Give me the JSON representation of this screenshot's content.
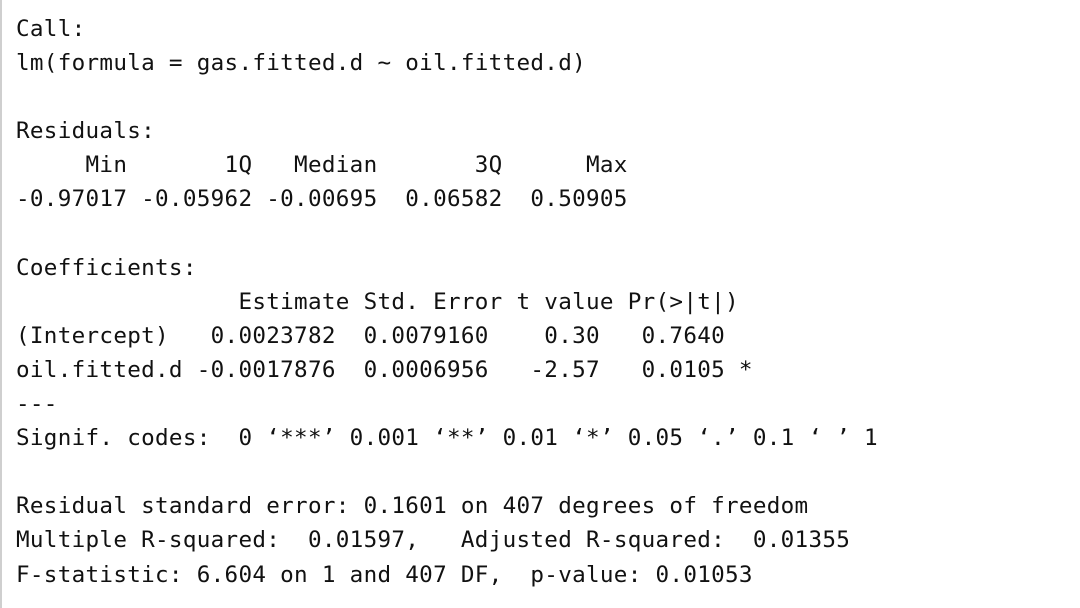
{
  "console": {
    "lines": [
      "Call:",
      "lm(formula = gas.fitted.d ~ oil.fitted.d)",
      "",
      "Residuals:",
      "     Min       1Q   Median       3Q      Max ",
      "-0.97017 -0.05962 -0.00695  0.06582  0.50905 ",
      "",
      "Coefficients:",
      "                Estimate Std. Error t value Pr(>|t|)  ",
      "(Intercept)   0.0023782  0.0079160    0.30   0.7640  ",
      "oil.fitted.d -0.0017876  0.0006956   -2.57   0.0105 *",
      "---",
      "Signif. codes:  0 ‘***’ 0.001 ‘**’ 0.01 ‘*’ 0.05 ‘.’ 0.1 ‘ ’ 1",
      "",
      "Residual standard error: 0.1601 on 407 degrees of freedom",
      "Multiple R-squared:  0.01597,\tAdjusted R-squared:  0.01355 ",
      "F-statistic: 6.604 on 1 and 407 DF,  p-value: 0.01053"
    ]
  }
}
